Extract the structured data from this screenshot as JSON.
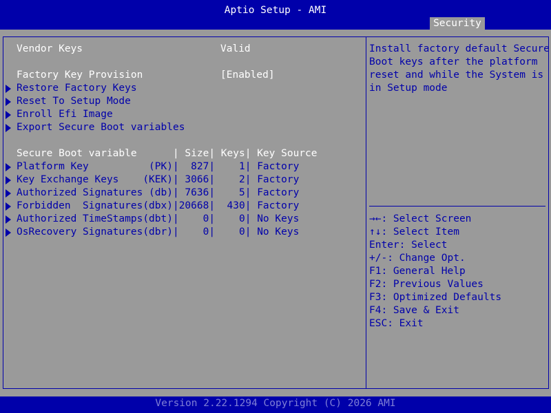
{
  "header": {
    "title": "Aptio Setup - AMI",
    "active_tab": "Security"
  },
  "vendor_keys": {
    "label": "Vendor Keys",
    "value": "Valid"
  },
  "factory_key_provision": {
    "label": "Factory Key Provision",
    "value": "[Enabled]"
  },
  "menu_items": [
    "Restore Factory Keys",
    "Reset To Setup Mode",
    "Enroll Efi Image",
    "Export Secure Boot variables"
  ],
  "variable_table": {
    "header": "Secure Boot variable      | Size| Keys| Key Source",
    "rows": [
      "Platform Key          (PK)|  827|    1| Factory",
      "Key Exchange Keys    (KEK)| 3066|    2| Factory",
      "Authorized Signatures (db)| 7636|    5| Factory",
      "Forbidden  Signatures(dbx)|20668|  430| Factory",
      "Authorized TimeStamps(dbt)|    0|    0| No Keys",
      "OsRecovery Signatures(dbr)|    0|    0| No Keys"
    ]
  },
  "help": {
    "lines": [
      "Install factory default Secure",
      "Boot keys after the platform",
      "reset and while the System is",
      "in Setup mode"
    ]
  },
  "keys_help": [
    "→←: Select Screen",
    "↑↓: Select Item",
    "Enter: Select",
    "+/-: Change Opt.",
    "F1: General Help",
    "F2: Previous Values",
    "F3: Optimized Defaults",
    "F4: Save & Exit",
    "ESC: Exit"
  ],
  "footer": {
    "text": "Version 2.22.1294 Copyright (C) 2026 AMI"
  },
  "colors": {
    "background": "#9a9a9a",
    "accent": "#0000aa",
    "text": "#ffffff",
    "footer_text": "#7f7fd5"
  }
}
